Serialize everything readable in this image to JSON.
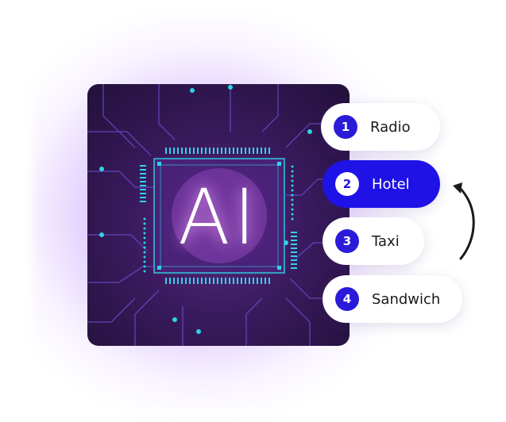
{
  "chip": {
    "text": "AI"
  },
  "list": [
    {
      "number": "1",
      "label": "Radio",
      "active": false
    },
    {
      "number": "2",
      "label": "Hotel",
      "active": true
    },
    {
      "number": "3",
      "label": "Taxi",
      "active": false
    },
    {
      "number": "4",
      "label": "Sandwich",
      "active": false
    }
  ],
  "colors": {
    "accent": "#1f12e6",
    "circuit": "#2fd3e6",
    "chip_bg": "#3a1a5e",
    "glow": "#8a4dff"
  },
  "icons": {
    "arrow": "curved-arrow-up-icon",
    "chip": "circuit-chip-icon"
  }
}
